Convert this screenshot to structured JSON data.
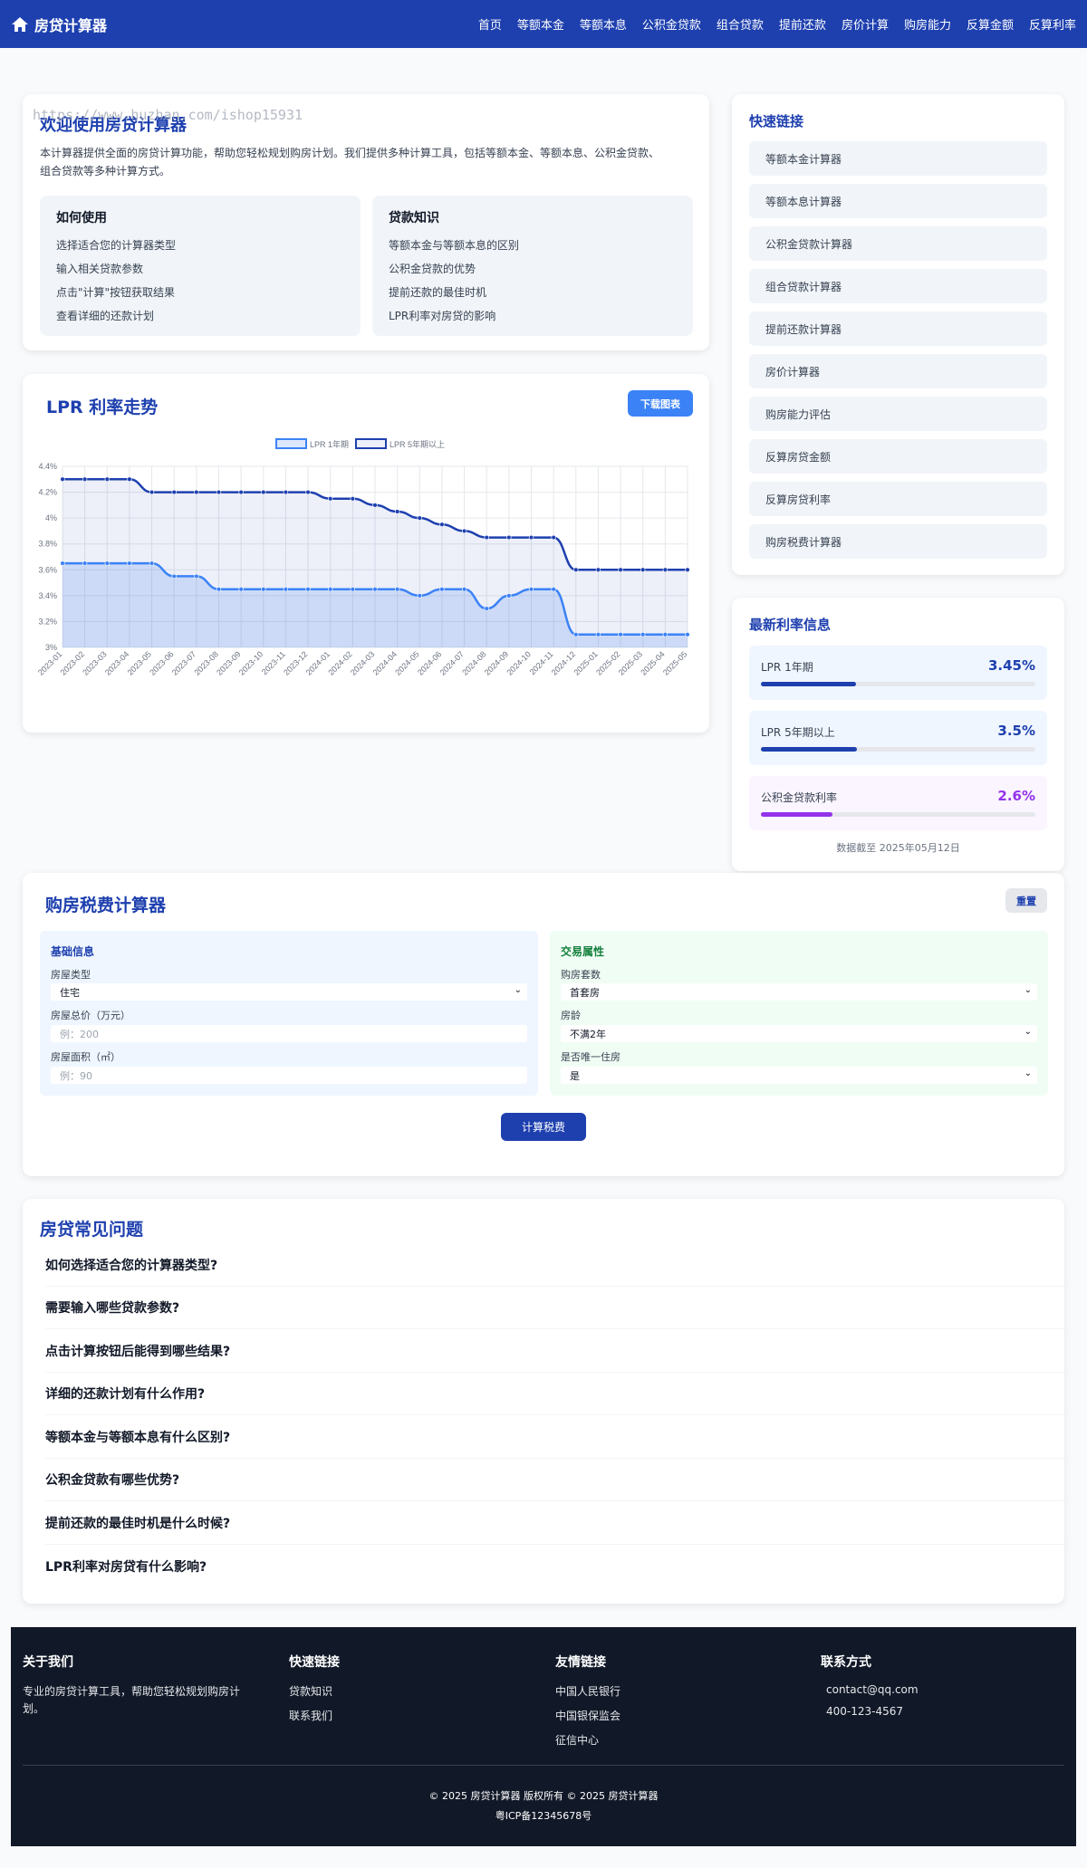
{
  "nav": {
    "brand": "房贷计算器",
    "links": [
      "首页",
      "等额本金",
      "等额本息",
      "公积金贷款",
      "组合贷款",
      "提前还款",
      "房价计算",
      "购房能力",
      "反算金额",
      "反算利率"
    ]
  },
  "watermark": "https://www.huzhan.com/ishop15931",
  "welcome": {
    "title": "欢迎使用房贷计算器",
    "desc_1": "本计算器提供全面的房贷计算功能，帮助您轻松规划购房计划。我们提供多种计算工具，包括等额本金、等额本息、公积金贷款、",
    "desc_2": "组合贷款等多种计算方式。",
    "howto": {
      "title": "如何使用",
      "items": [
        "选择适合您的计算器类型",
        "输入相关贷款参数",
        "点击\"计算\"按钮获取结果",
        "查看详细的还款计划"
      ]
    },
    "knowledge": {
      "title": "贷款知识",
      "items": [
        "等额本金与等额本息的区别",
        "公积金贷款的优势",
        "提前还款的最佳时机",
        "LPR利率对房贷的影响"
      ]
    }
  },
  "quick_links": {
    "title": "快速链接",
    "items": [
      "等额本金计算器",
      "等额本息计算器",
      "公积金贷款计算器",
      "组合贷款计算器",
      "提前还款计算器",
      "房价计算器",
      "购房能力评估",
      "反算房贷金额",
      "反算房贷利率",
      "购房税费计算器"
    ]
  },
  "lpr_card": {
    "title": "LPR 利率走势",
    "download": "下载图表"
  },
  "chart_data": {
    "type": "line",
    "title": "",
    "xlabel": "",
    "ylabel": "",
    "categories": [
      "2023-01",
      "2023-02",
      "2023-03",
      "2023-04",
      "2023-05",
      "2023-06",
      "2023-07",
      "2023-08",
      "2023-09",
      "2023-10",
      "2023-11",
      "2023-12",
      "2024-01",
      "2024-02",
      "2024-03",
      "2024-04",
      "2024-05",
      "2024-06",
      "2024-07",
      "2024-08",
      "2024-09",
      "2024-10",
      "2024-11",
      "2024-12",
      "2025-01",
      "2025-02",
      "2025-03",
      "2025-04",
      "2025-05"
    ],
    "ylim": [
      3,
      4.4
    ],
    "yticks": [
      "3%",
      "3.2%",
      "3.4%",
      "3.6%",
      "3.8%",
      "4%",
      "4.2%",
      "4.4%"
    ],
    "grid": true,
    "legend_position": "top",
    "series": [
      {
        "name": "LPR 1年期",
        "color": "#3b82f6",
        "fill": "rgba(59,130,246,0.18)",
        "values": [
          3.65,
          3.65,
          3.65,
          3.65,
          3.65,
          3.55,
          3.55,
          3.45,
          3.45,
          3.45,
          3.45,
          3.45,
          3.45,
          3.45,
          3.45,
          3.45,
          3.4,
          3.45,
          3.45,
          3.3,
          3.4,
          3.45,
          3.45,
          3.1,
          3.1,
          3.1,
          3.1,
          3.1,
          3.1
        ]
      },
      {
        "name": "LPR 5年期以上",
        "color": "#1e40af",
        "fill": "rgba(30,64,175,0.08)",
        "values": [
          4.3,
          4.3,
          4.3,
          4.3,
          4.2,
          4.2,
          4.2,
          4.2,
          4.2,
          4.2,
          4.2,
          4.2,
          4.15,
          4.15,
          4.1,
          4.05,
          4.0,
          3.95,
          3.9,
          3.85,
          3.85,
          3.85,
          3.85,
          3.6,
          3.6,
          3.6,
          3.6,
          3.6,
          3.6
        ]
      }
    ]
  },
  "rates": {
    "title": "最新利率信息",
    "items": [
      {
        "label": "LPR 1年期",
        "value": "3.45%",
        "fraction": 0.345,
        "color": "#1e40af",
        "bg": "#eff6ff"
      },
      {
        "label": "LPR 5年期以上",
        "value": "3.5%",
        "fraction": 0.35,
        "color": "#1e40af",
        "bg": "#eff6ff"
      },
      {
        "label": "公积金贷款利率",
        "value": "2.6%",
        "fraction": 0.26,
        "color": "#9333ea",
        "bg": "#faf5ff"
      }
    ],
    "note": "数据截至 2025年05月12日"
  },
  "tax": {
    "title": "购房税费计算器",
    "reset": "重置",
    "calc": "计算税费",
    "basic": {
      "title": "基础信息",
      "type_label": "房屋类型",
      "type_value": "住宅",
      "price_label": "房屋总价（万元）",
      "price_ph": "例：200",
      "area_label": "房屋面积（㎡）",
      "area_ph": "例：90"
    },
    "trade": {
      "title": "交易属性",
      "count_label": "购房套数",
      "count_value": "首套房",
      "age_label": "房龄",
      "age_value": "不满2年",
      "only_label": "是否唯一住房",
      "only_value": "是"
    }
  },
  "faq": {
    "title": "房贷常见问题",
    "items": [
      "如何选择适合您的计算器类型?",
      "需要输入哪些贷款参数?",
      "点击计算按钮后能得到哪些结果?",
      "详细的还款计划有什么作用?",
      "等额本金与等额本息有什么区别?",
      "公积金贷款有哪些优势?",
      "提前还款的最佳时机是什么时候?",
      "LPR利率对房贷有什么影响?"
    ]
  },
  "footer": {
    "about_title": "关于我们",
    "about_text_1": "专业的房贷计算工具，帮助您轻松规划购房计",
    "about_text_2": "划。",
    "quick_title": "快速链接",
    "quick_items": [
      "贷款知识",
      "联系我们"
    ],
    "friends_title": "友情链接",
    "friends_items": [
      "中国人民银行",
      "中国银保监会",
      "征信中心"
    ],
    "contact_title": "联系方式",
    "email": "contact@qq.com",
    "phone": "400-123-4567",
    "copyright": "© 2025 房贷计算器 版权所有 © 2025 房贷计算器",
    "icp": "粤ICP备12345678号"
  }
}
